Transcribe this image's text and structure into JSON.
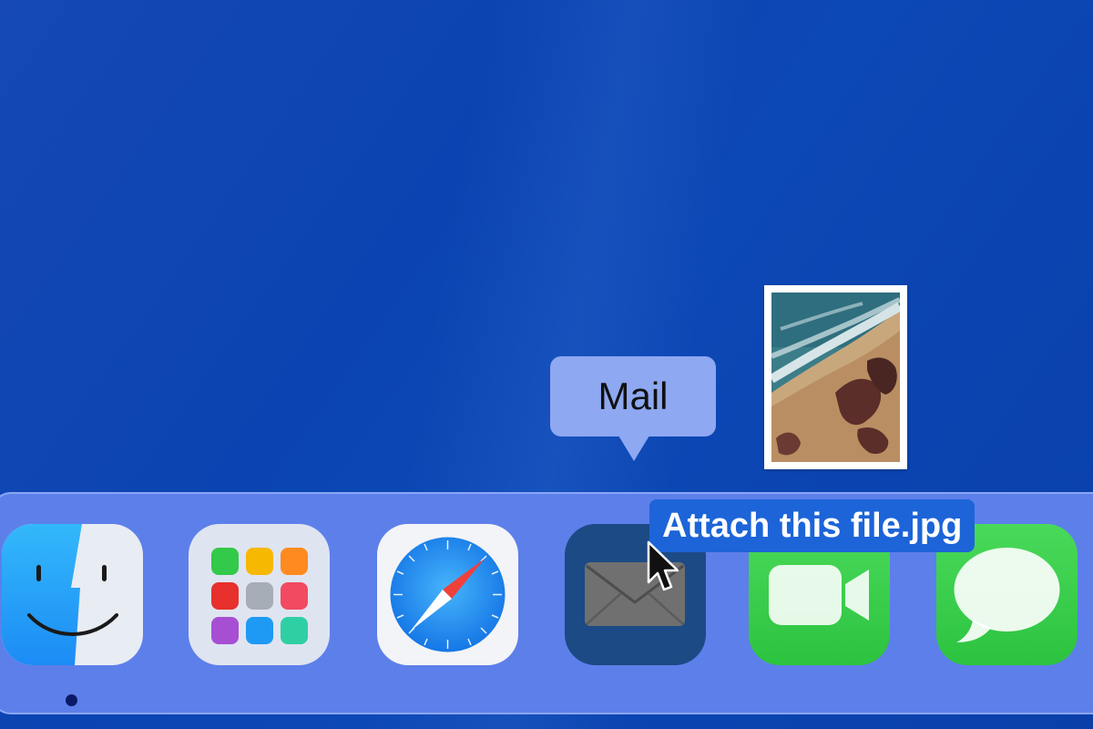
{
  "dock": {
    "items": [
      {
        "name": "Finder",
        "running": true
      },
      {
        "name": "Launchpad",
        "running": false
      },
      {
        "name": "Safari",
        "running": false
      },
      {
        "name": "Mail",
        "running": false
      },
      {
        "name": "FaceTime",
        "running": false
      },
      {
        "name": "Messages",
        "running": false
      }
    ],
    "hovered_item": "mail-dock-icon"
  },
  "tooltip": {
    "label": "Mail"
  },
  "drag": {
    "filename": "Attach this file.jpg",
    "thumbnail_icon": "beach-aerial-photo"
  },
  "colors": {
    "desktop": "#0c48b6",
    "dock": "#5d7fea",
    "tooltip": "#8ea8f1",
    "file_label": "#1c64d8",
    "mail_tile": "#1c4a85",
    "green_tile": "#2cc33f"
  },
  "icons": [
    "finder-icon",
    "launchpad-icon",
    "safari-icon",
    "mail-icon",
    "facetime-icon",
    "messages-icon",
    "cursor-icon"
  ]
}
